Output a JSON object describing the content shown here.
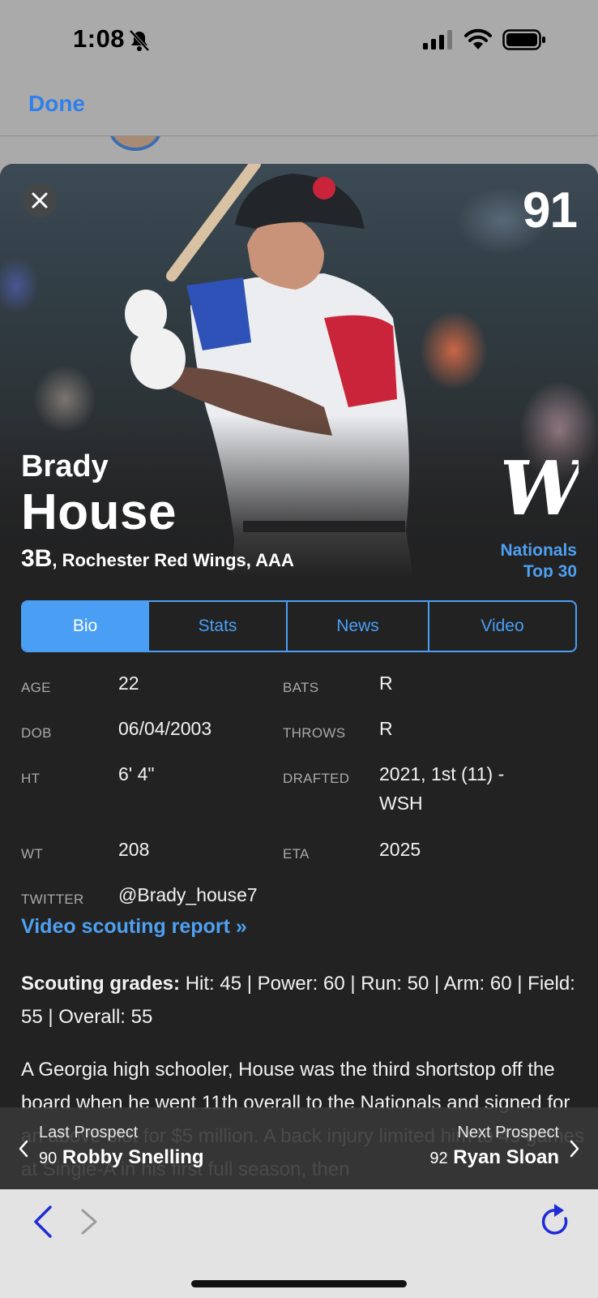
{
  "status_bar": {
    "time": "1:08",
    "icons": [
      "bell-slash-icon",
      "signal-icon",
      "wifi-icon",
      "battery-icon"
    ]
  },
  "nav": {
    "done_label": "Done"
  },
  "prospect": {
    "rank": "91",
    "first_name": "Brady",
    "last_name": "House",
    "position": "3B",
    "team_line": ", Rochester Red Wings, AAA",
    "org_link_line1": "Nationals",
    "org_link_line2": "Top 30"
  },
  "tabs": [
    {
      "label": "Bio",
      "active": true
    },
    {
      "label": "Stats",
      "active": false
    },
    {
      "label": "News",
      "active": false
    },
    {
      "label": "Video",
      "active": false
    }
  ],
  "bio": {
    "age_label": "AGE",
    "age": "22",
    "bats_label": "BATS",
    "bats": "R",
    "dob_label": "DOB",
    "dob": "06/04/2003",
    "throws_label": "THROWS",
    "throws": "R",
    "ht_label": "HT",
    "ht": "6' 4\"",
    "drafted_label": "DRAFTED",
    "drafted": "2021, 1st (11) - WSH",
    "wt_label": "WT",
    "wt": "208",
    "eta_label": "ETA",
    "eta": "2025",
    "twitter_label": "TWITTER",
    "twitter": "@Brady_house7"
  },
  "video_link": "Video scouting report »",
  "grades": {
    "label": "Scouting grades:",
    "text": " Hit: 45 | Power: 60 | Run: 50 | Arm: 60 | Field: 55 | Overall: 55"
  },
  "summary": "A Georgia high schooler, House was the third shortstop off the board when he went 11th overall to the Nationals and signed for an above-slot for $5 million. A back injury limited him to 45 games at Single-A in his first full season, then",
  "prospect_nav": {
    "prev_label": "Last Prospect",
    "prev_num": "90",
    "prev_name": "Robby Snelling",
    "next_label": "Next Prospect",
    "next_num": "92",
    "next_name": "Ryan Sloan"
  },
  "colors": {
    "accent": "#4a9ff5",
    "link": "#4ea0f0",
    "done": "#2f80ed",
    "card_bg": "#222223",
    "toolbar_bg": "#e3e3e3",
    "toolbar_icon": "#1f2bd6"
  }
}
